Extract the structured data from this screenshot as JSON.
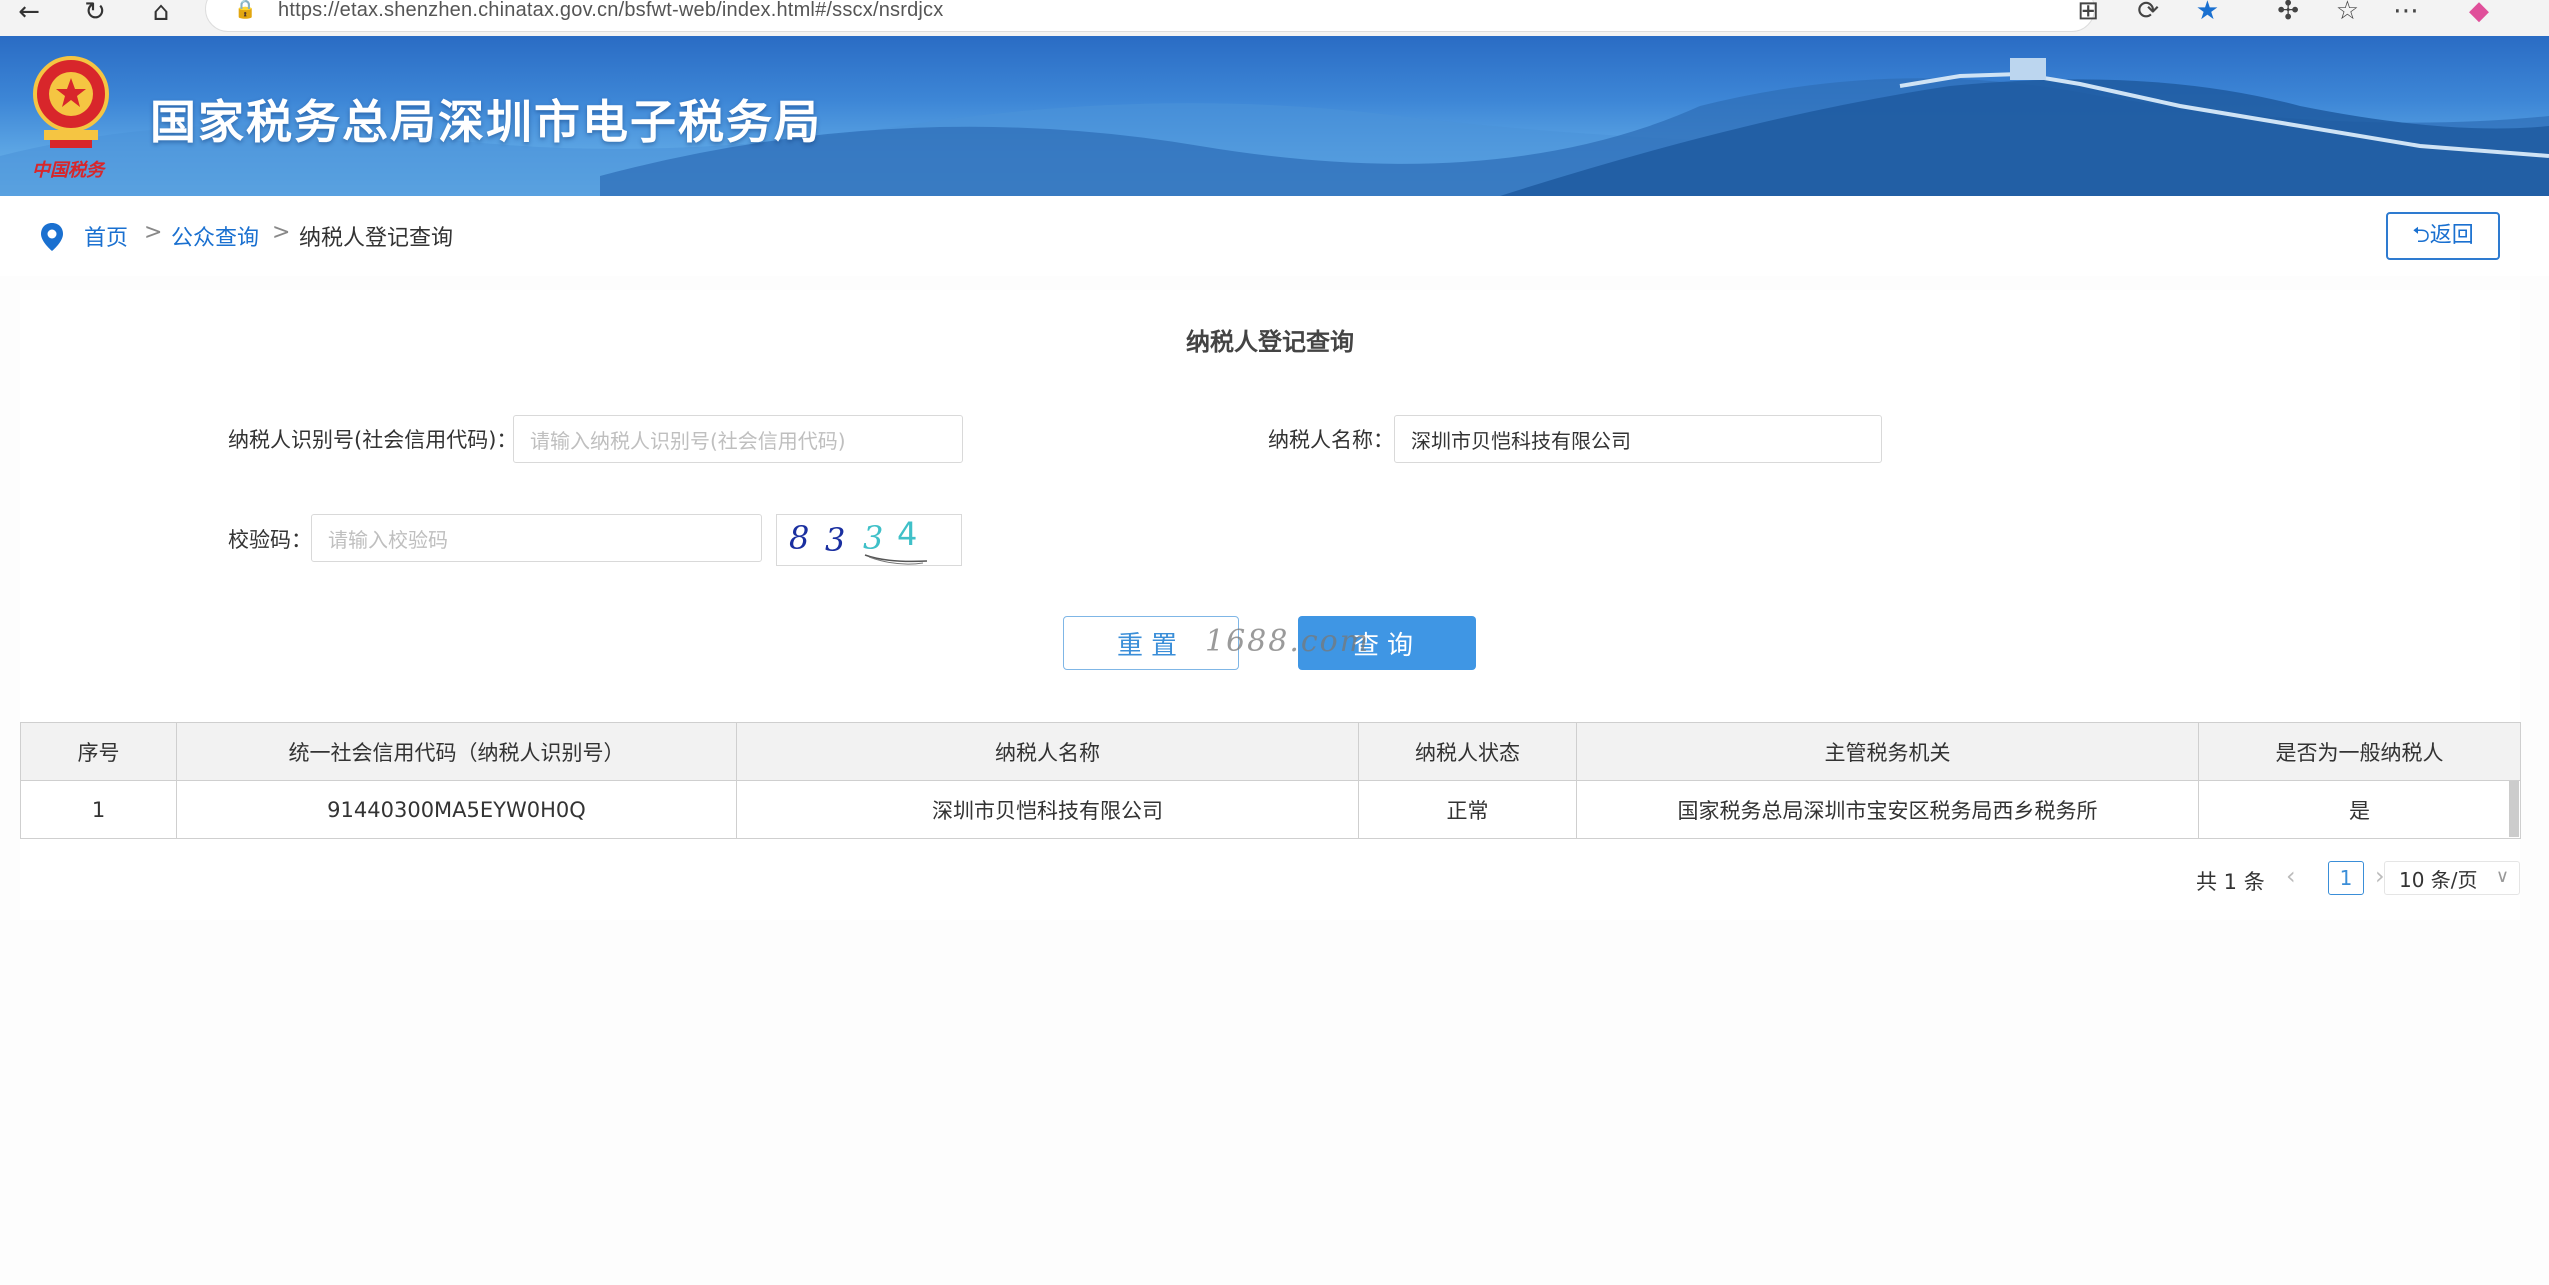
{
  "browser": {
    "url": "https://etax.shenzhen.chinatax.gov.cn/bsfwt-web/index.html#/sscx/nsrdjcx",
    "icons": [
      "back-arrow-icon",
      "refresh-icon",
      "home-icon",
      "lock-icon",
      "apps-icon",
      "sync-icon",
      "star-icon",
      "extensions-icon",
      "favorites-icon",
      "more-icon",
      "copilot-icon"
    ]
  },
  "header": {
    "site_title": "国家税务总局深圳市电子税务局",
    "emblem_signature": "中国税务"
  },
  "breadcrumb": {
    "items": [
      "首页",
      "公众查询",
      "纳税人登记查询"
    ],
    "separator": ">",
    "back_label": "⮌返回"
  },
  "form": {
    "title": "纳税人登记查询",
    "taxpayer_id_label": "纳税人识别号(社会信用代码)：",
    "taxpayer_id_placeholder": "请输入纳税人识别号(社会信用代码)",
    "taxpayer_name_label": "纳税人名称：",
    "taxpayer_name_value": "深圳市贝恺科技有限公司",
    "captcha_label": "校验码：",
    "captcha_placeholder": "请输入校验码",
    "captcha_text": "8334",
    "reset_label": "重置",
    "query_label": "查询"
  },
  "watermark": "1688.com",
  "table": {
    "headers": [
      "序号",
      "统一社会信用代码（纳税人识别号）",
      "纳税人名称",
      "纳税人状态",
      "主管税务机关",
      "是否为一般纳税人"
    ],
    "rows": [
      [
        "1",
        "91440300MA5EYW0H0Q",
        "深圳市贝恺科技有限公司",
        "正常",
        "国家税务总局深圳市宝安区税务局西乡税务所",
        "是"
      ]
    ]
  },
  "pagination": {
    "total_text": "共 1 条",
    "current_page": "1",
    "page_size": "10 条/页"
  },
  "colors": {
    "accent": "#3f96e4",
    "link": "#1a70d0",
    "banner": "#3d86d6"
  }
}
